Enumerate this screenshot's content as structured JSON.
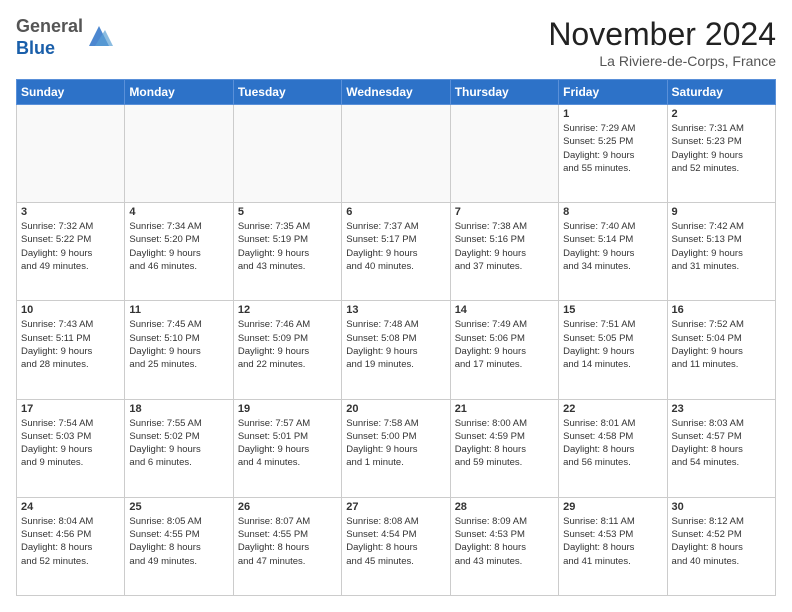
{
  "header": {
    "logo": {
      "line1": "General",
      "line2": "Blue"
    },
    "month": "November 2024",
    "location": "La Riviere-de-Corps, France"
  },
  "weekdays": [
    "Sunday",
    "Monday",
    "Tuesday",
    "Wednesday",
    "Thursday",
    "Friday",
    "Saturday"
  ],
  "weeks": [
    [
      {
        "day": "",
        "info": ""
      },
      {
        "day": "",
        "info": ""
      },
      {
        "day": "",
        "info": ""
      },
      {
        "day": "",
        "info": ""
      },
      {
        "day": "",
        "info": ""
      },
      {
        "day": "1",
        "info": "Sunrise: 7:29 AM\nSunset: 5:25 PM\nDaylight: 9 hours\nand 55 minutes."
      },
      {
        "day": "2",
        "info": "Sunrise: 7:31 AM\nSunset: 5:23 PM\nDaylight: 9 hours\nand 52 minutes."
      }
    ],
    [
      {
        "day": "3",
        "info": "Sunrise: 7:32 AM\nSunset: 5:22 PM\nDaylight: 9 hours\nand 49 minutes."
      },
      {
        "day": "4",
        "info": "Sunrise: 7:34 AM\nSunset: 5:20 PM\nDaylight: 9 hours\nand 46 minutes."
      },
      {
        "day": "5",
        "info": "Sunrise: 7:35 AM\nSunset: 5:19 PM\nDaylight: 9 hours\nand 43 minutes."
      },
      {
        "day": "6",
        "info": "Sunrise: 7:37 AM\nSunset: 5:17 PM\nDaylight: 9 hours\nand 40 minutes."
      },
      {
        "day": "7",
        "info": "Sunrise: 7:38 AM\nSunset: 5:16 PM\nDaylight: 9 hours\nand 37 minutes."
      },
      {
        "day": "8",
        "info": "Sunrise: 7:40 AM\nSunset: 5:14 PM\nDaylight: 9 hours\nand 34 minutes."
      },
      {
        "day": "9",
        "info": "Sunrise: 7:42 AM\nSunset: 5:13 PM\nDaylight: 9 hours\nand 31 minutes."
      }
    ],
    [
      {
        "day": "10",
        "info": "Sunrise: 7:43 AM\nSunset: 5:11 PM\nDaylight: 9 hours\nand 28 minutes."
      },
      {
        "day": "11",
        "info": "Sunrise: 7:45 AM\nSunset: 5:10 PM\nDaylight: 9 hours\nand 25 minutes."
      },
      {
        "day": "12",
        "info": "Sunrise: 7:46 AM\nSunset: 5:09 PM\nDaylight: 9 hours\nand 22 minutes."
      },
      {
        "day": "13",
        "info": "Sunrise: 7:48 AM\nSunset: 5:08 PM\nDaylight: 9 hours\nand 19 minutes."
      },
      {
        "day": "14",
        "info": "Sunrise: 7:49 AM\nSunset: 5:06 PM\nDaylight: 9 hours\nand 17 minutes."
      },
      {
        "day": "15",
        "info": "Sunrise: 7:51 AM\nSunset: 5:05 PM\nDaylight: 9 hours\nand 14 minutes."
      },
      {
        "day": "16",
        "info": "Sunrise: 7:52 AM\nSunset: 5:04 PM\nDaylight: 9 hours\nand 11 minutes."
      }
    ],
    [
      {
        "day": "17",
        "info": "Sunrise: 7:54 AM\nSunset: 5:03 PM\nDaylight: 9 hours\nand 9 minutes."
      },
      {
        "day": "18",
        "info": "Sunrise: 7:55 AM\nSunset: 5:02 PM\nDaylight: 9 hours\nand 6 minutes."
      },
      {
        "day": "19",
        "info": "Sunrise: 7:57 AM\nSunset: 5:01 PM\nDaylight: 9 hours\nand 4 minutes."
      },
      {
        "day": "20",
        "info": "Sunrise: 7:58 AM\nSunset: 5:00 PM\nDaylight: 9 hours\nand 1 minute."
      },
      {
        "day": "21",
        "info": "Sunrise: 8:00 AM\nSunset: 4:59 PM\nDaylight: 8 hours\nand 59 minutes."
      },
      {
        "day": "22",
        "info": "Sunrise: 8:01 AM\nSunset: 4:58 PM\nDaylight: 8 hours\nand 56 minutes."
      },
      {
        "day": "23",
        "info": "Sunrise: 8:03 AM\nSunset: 4:57 PM\nDaylight: 8 hours\nand 54 minutes."
      }
    ],
    [
      {
        "day": "24",
        "info": "Sunrise: 8:04 AM\nSunset: 4:56 PM\nDaylight: 8 hours\nand 52 minutes."
      },
      {
        "day": "25",
        "info": "Sunrise: 8:05 AM\nSunset: 4:55 PM\nDaylight: 8 hours\nand 49 minutes."
      },
      {
        "day": "26",
        "info": "Sunrise: 8:07 AM\nSunset: 4:55 PM\nDaylight: 8 hours\nand 47 minutes."
      },
      {
        "day": "27",
        "info": "Sunrise: 8:08 AM\nSunset: 4:54 PM\nDaylight: 8 hours\nand 45 minutes."
      },
      {
        "day": "28",
        "info": "Sunrise: 8:09 AM\nSunset: 4:53 PM\nDaylight: 8 hours\nand 43 minutes."
      },
      {
        "day": "29",
        "info": "Sunrise: 8:11 AM\nSunset: 4:53 PM\nDaylight: 8 hours\nand 41 minutes."
      },
      {
        "day": "30",
        "info": "Sunrise: 8:12 AM\nSunset: 4:52 PM\nDaylight: 8 hours\nand 40 minutes."
      }
    ]
  ]
}
